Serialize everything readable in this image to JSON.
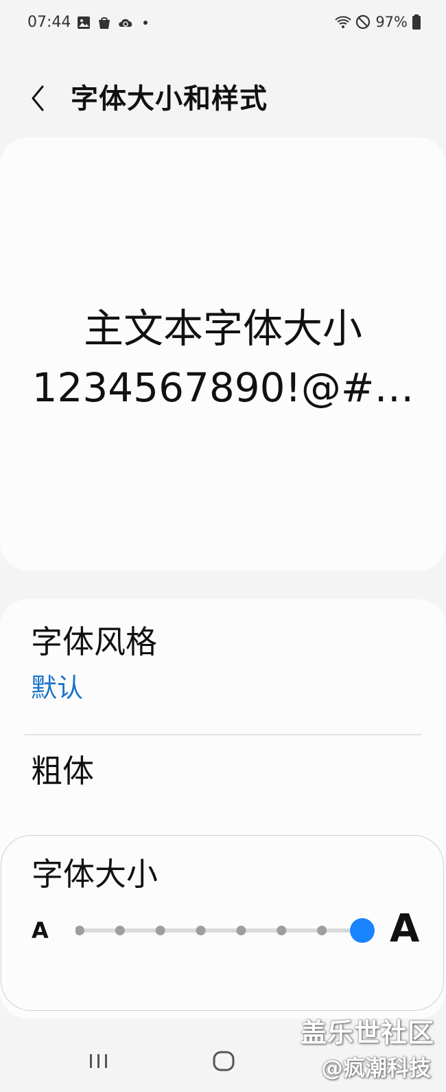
{
  "status_bar": {
    "time": "07:44",
    "battery": "97%",
    "left_icons": [
      "gallery-icon",
      "shopping-bag-icon",
      "cloud-sync-icon",
      "notification-dot-icon"
    ],
    "right_icons": [
      "wifi-icon",
      "do-not-disturb-icon",
      "battery-icon"
    ]
  },
  "header": {
    "title": "字体大小和样式",
    "back_icon": "chevron-left-icon"
  },
  "preview": {
    "line1": "主文本字体大小",
    "line2": "1234567890!@#…"
  },
  "font_style": {
    "title": "字体风格",
    "value": "默认"
  },
  "bold": {
    "title": "粗体"
  },
  "font_size": {
    "title": "字体大小",
    "small_label": "A",
    "large_label": "A",
    "slider": {
      "steps": 8,
      "selected_index": 7
    }
  },
  "watermark": {
    "line1": "盖乐世社区",
    "line2": "@疯潮科技"
  },
  "nav_bar": {
    "icons": [
      "recents-icon",
      "home-icon"
    ]
  },
  "colors": {
    "accent": "#1a73c8",
    "slider_thumb": "#1a84ff",
    "background": "#f4f4f4",
    "card": "#fcfcfc"
  }
}
